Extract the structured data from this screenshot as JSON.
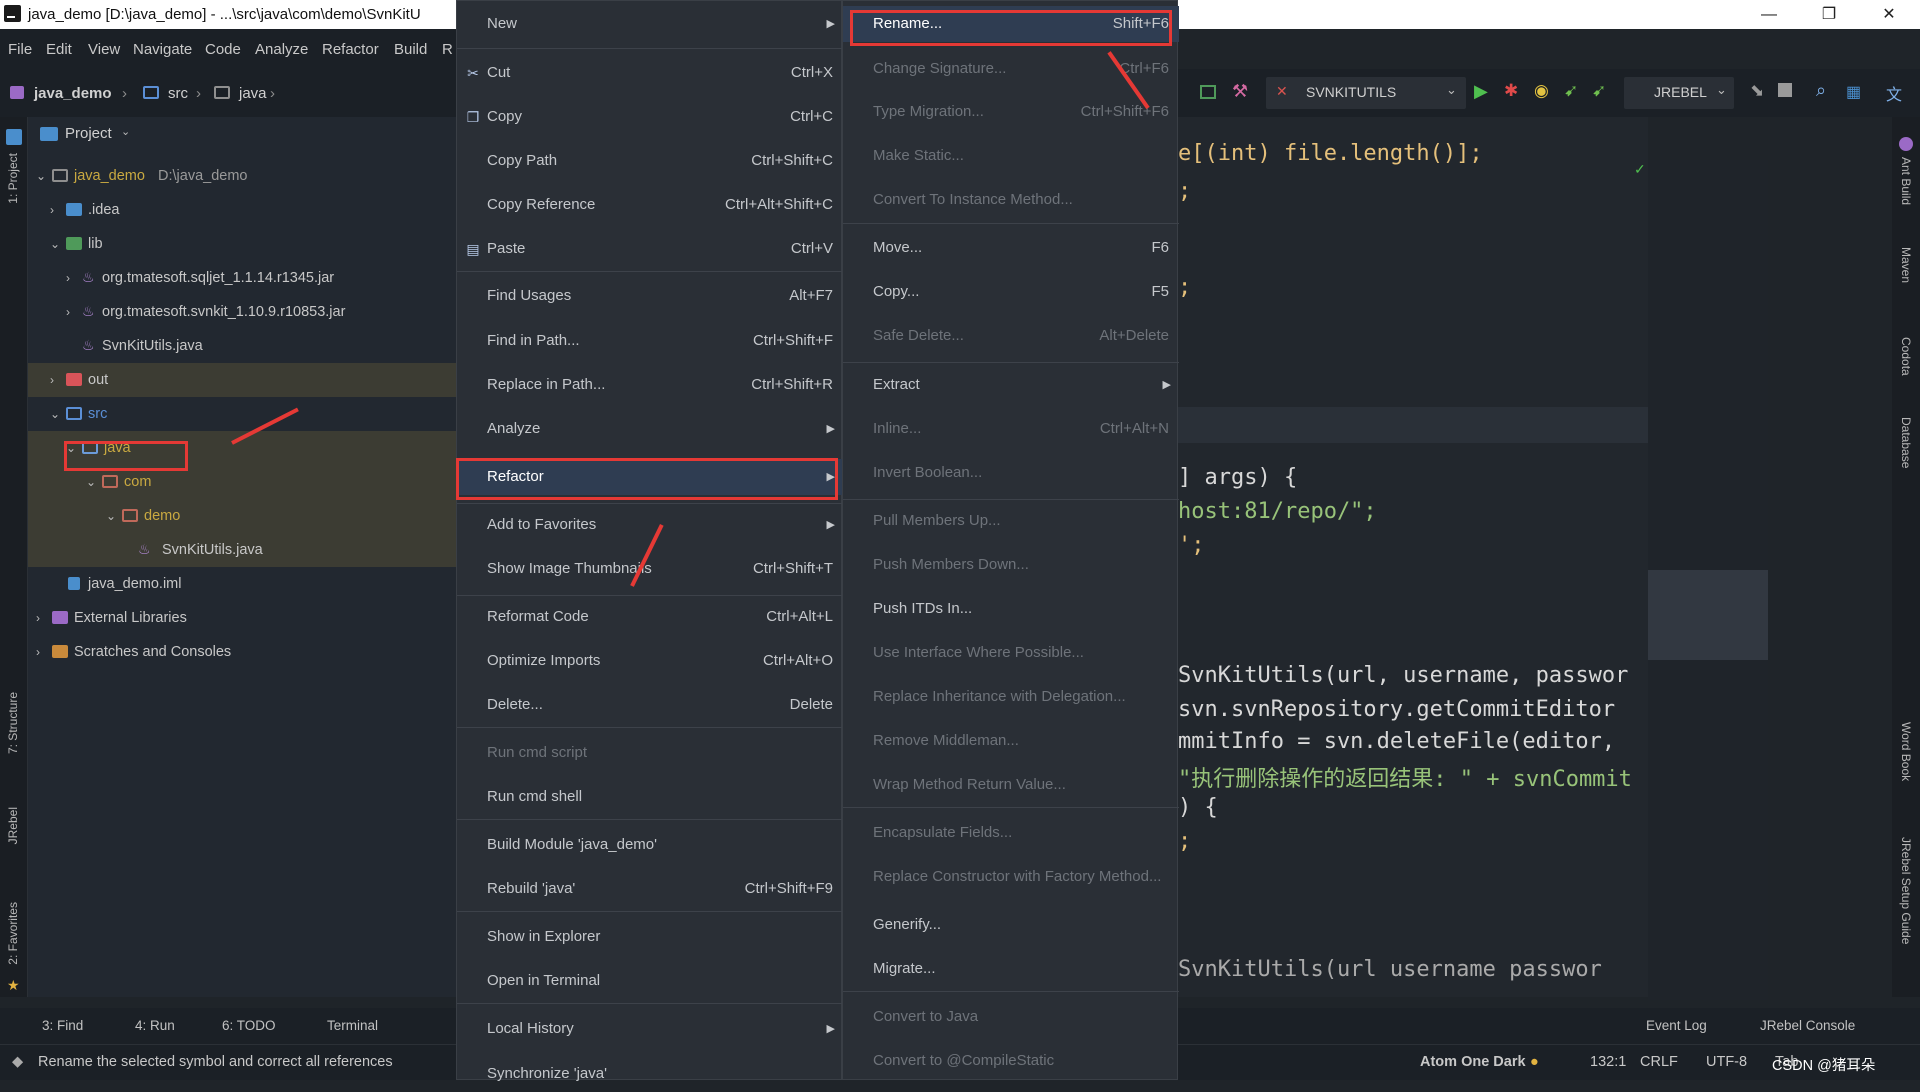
{
  "window": {
    "title": "java_demo [D:\\java_demo] - ...\\src\\java\\com\\demo\\SvnKitU",
    "controls": [
      "—",
      "❐",
      "✕"
    ]
  },
  "menubar": [
    "File",
    "Edit",
    "View",
    "Navigate",
    "Code",
    "Analyze",
    "Refactor",
    "Build",
    "R"
  ],
  "breadcrumb": [
    "java_demo",
    "src",
    "java"
  ],
  "project_panel": {
    "header": "Project",
    "tree": [
      {
        "label": "java_demo",
        "extra": "D:\\java_demo"
      },
      {
        "label": ".idea"
      },
      {
        "label": "lib"
      },
      {
        "label": "org.tmatesoft.sqljet_1.1.14.r1345.jar"
      },
      {
        "label": "org.tmatesoft.svnkit_1.10.9.r10853.jar"
      },
      {
        "label": "SvnKitUtils.java"
      },
      {
        "label": "out"
      },
      {
        "label": "src"
      },
      {
        "label": "java"
      },
      {
        "label": "com"
      },
      {
        "label": "demo"
      },
      {
        "label": "SvnKitUtils.java"
      },
      {
        "label": "java_demo.iml"
      },
      {
        "label": "External Libraries"
      },
      {
        "label": "Scratches and Consoles"
      }
    ]
  },
  "left_strip": [
    "1: Project",
    "7: Structure",
    "JRebel",
    "2: Favorites"
  ],
  "context_menu": {
    "items": [
      {
        "label": "New",
        "shortcut": "",
        "submenu": true
      },
      {
        "label": "Cut",
        "shortcut": "Ctrl+X",
        "icon": "scissors-icon"
      },
      {
        "label": "Copy",
        "shortcut": "Ctrl+C",
        "icon": "copy-icon"
      },
      {
        "label": "Copy Path",
        "shortcut": "Ctrl+Shift+C"
      },
      {
        "label": "Copy Reference",
        "shortcut": "Ctrl+Alt+Shift+C"
      },
      {
        "label": "Paste",
        "shortcut": "Ctrl+V",
        "icon": "paste-icon"
      },
      {
        "label": "Find Usages",
        "shortcut": "Alt+F7"
      },
      {
        "label": "Find in Path...",
        "shortcut": "Ctrl+Shift+F"
      },
      {
        "label": "Replace in Path...",
        "shortcut": "Ctrl+Shift+R"
      },
      {
        "label": "Analyze",
        "shortcut": "",
        "submenu": true
      },
      {
        "label": "Refactor",
        "shortcut": "",
        "submenu": true
      },
      {
        "label": "Add to Favorites",
        "shortcut": "",
        "submenu": true
      },
      {
        "label": "Show Image Thumbnails",
        "shortcut": "Ctrl+Shift+T"
      },
      {
        "label": "Reformat Code",
        "shortcut": "Ctrl+Alt+L"
      },
      {
        "label": "Optimize Imports",
        "shortcut": "Ctrl+Alt+O"
      },
      {
        "label": "Delete...",
        "shortcut": "Delete"
      },
      {
        "label": "Run cmd script",
        "shortcut": "",
        "disabled": true
      },
      {
        "label": "Run cmd shell",
        "shortcut": ""
      },
      {
        "label": "Build Module 'java_demo'",
        "shortcut": ""
      },
      {
        "label": "Rebuild 'java'",
        "shortcut": "Ctrl+Shift+F9"
      },
      {
        "label": "Show in Explorer",
        "shortcut": ""
      },
      {
        "label": "Open in Terminal",
        "shortcut": ""
      },
      {
        "label": "Local History",
        "shortcut": "",
        "submenu": true
      },
      {
        "label": "Synchronize 'java'",
        "shortcut": ""
      }
    ]
  },
  "refactor_menu": {
    "items": [
      {
        "label": "Rename...",
        "shortcut": "Shift+F6"
      },
      {
        "label": "Change Signature...",
        "shortcut": "Ctrl+F6",
        "disabled": true
      },
      {
        "label": "Type Migration...",
        "shortcut": "Ctrl+Shift+F6",
        "disabled": true
      },
      {
        "label": "Make Static...",
        "shortcut": "",
        "disabled": true
      },
      {
        "label": "Convert To Instance Method...",
        "shortcut": "",
        "disabled": true
      },
      {
        "label": "Move...",
        "shortcut": "F6"
      },
      {
        "label": "Copy...",
        "shortcut": "F5"
      },
      {
        "label": "Safe Delete...",
        "shortcut": "Alt+Delete",
        "disabled": true
      },
      {
        "label": "Extract",
        "shortcut": "",
        "submenu": true
      },
      {
        "label": "Inline...",
        "shortcut": "Ctrl+Alt+N",
        "disabled": true
      },
      {
        "label": "Invert Boolean...",
        "shortcut": "",
        "disabled": true
      },
      {
        "label": "Pull Members Up...",
        "shortcut": "",
        "disabled": true
      },
      {
        "label": "Push Members Down...",
        "shortcut": "",
        "disabled": true
      },
      {
        "label": "Push ITDs In...",
        "shortcut": ""
      },
      {
        "label": "Use Interface Where Possible...",
        "shortcut": "",
        "disabled": true
      },
      {
        "label": "Replace Inheritance with Delegation...",
        "shortcut": "",
        "disabled": true
      },
      {
        "label": "Remove Middleman...",
        "shortcut": "",
        "disabled": true
      },
      {
        "label": "Wrap Method Return Value...",
        "shortcut": "",
        "disabled": true
      },
      {
        "label": "Encapsulate Fields...",
        "shortcut": "",
        "disabled": true
      },
      {
        "label": "Replace Constructor with Factory Method...",
        "shortcut": "",
        "disabled": true
      },
      {
        "label": "Generify...",
        "shortcut": ""
      },
      {
        "label": "Migrate...",
        "shortcut": ""
      },
      {
        "label": "Convert to Java",
        "shortcut": "",
        "disabled": true
      },
      {
        "label": "Convert to @CompileStatic",
        "shortcut": "",
        "disabled": true
      }
    ]
  },
  "toolbar": {
    "run_config": "SVNKITUTILS",
    "jrebel": "JREBEL"
  },
  "editor": {
    "lines": [
      "e[(int) file.length()];",
      ";",
      ";",
      "] args) {",
      "host:81/repo/\";",
      "';",
      "SvnKitUtils(url, username, passwor",
      " svn.svnRepository.getCommitEditor",
      "mmitInfo = svn.deleteFile(editor,",
      "\"执行删除操作的返回结果: \" + svnCommit",
      ") {",
      ";",
      "SvnKitUtils(url  username  passwor"
    ]
  },
  "right_strip": [
    "Ant Build",
    "Maven",
    "Codota",
    "Database",
    "Word Book",
    "JRebel Setup Guide"
  ],
  "bottom_tools": [
    "3: Find",
    "4: Run",
    "6: TODO",
    "Terminal",
    "Event Log",
    "JRebel Console"
  ],
  "status": {
    "message": "Rename the selected symbol and correct all references",
    "theme": "Atom One Dark",
    "position": "132:1",
    "line_sep": "CRLF",
    "encoding": "UTF-8",
    "indent": "Tab",
    "watermark": "CSDN @猪耳朵"
  },
  "colors": {
    "highlight_box": "#e53935",
    "menu_bg": "#2a2f36",
    "selection": "#2f3d52"
  }
}
